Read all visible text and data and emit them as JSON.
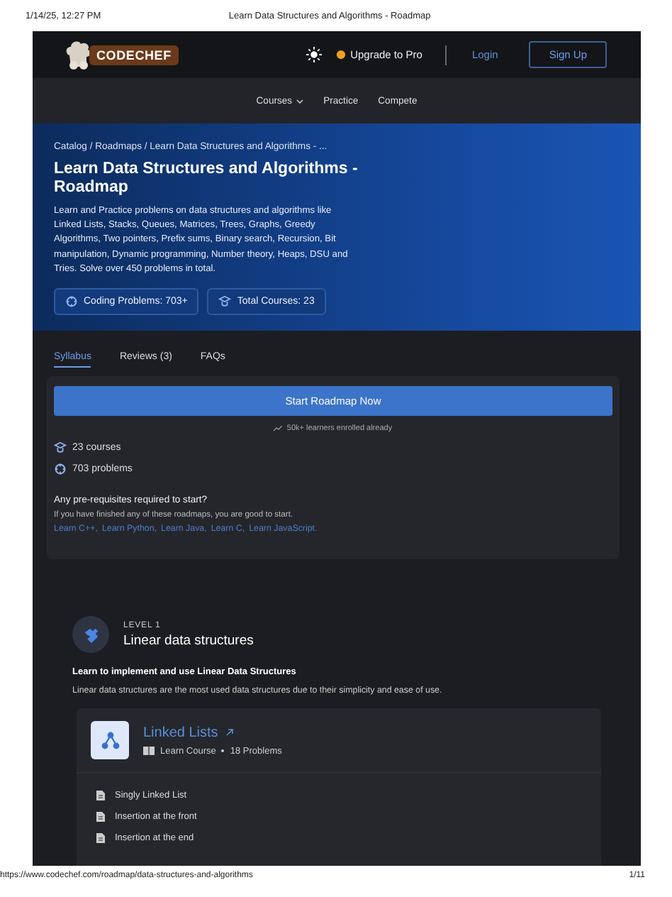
{
  "print_header": {
    "date": "1/14/25, 12:27 PM",
    "title": "Learn Data Structures and Algorithms - Roadmap"
  },
  "header": {
    "logo": "CODECHEF",
    "upgrade": "Upgrade to Pro",
    "login": "Login",
    "signup": "Sign Up"
  },
  "nav": [
    {
      "label": "Courses",
      "dropdown": true
    },
    {
      "label": "Practice",
      "dropdown": false
    },
    {
      "label": "Compete",
      "dropdown": false
    }
  ],
  "hero": {
    "breadcrumb": "Catalog / Roadmaps / Learn Data Structures and Algorithms - ...",
    "title": "Learn Data Structures and Algorithms - Roadmap",
    "description": "Learn and Practice problems on data structures and algorithms like Linked Lists, Stacks, Queues, Matrices, Trees, Graphs, Greedy Algorithms, Two pointers, Prefix sums, Binary search, Recursion, Bit manipulation, Dynamic programming, Number theory, Heaps, DSU and Tries. Solve over 450 problems in total.",
    "stats": [
      {
        "kind": "problems",
        "label": "Coding Problems: 703+"
      },
      {
        "kind": "courses",
        "label": "Total Courses: 23"
      }
    ]
  },
  "tabs": [
    {
      "label": "Syllabus",
      "selected": true
    },
    {
      "label": "Reviews (3)",
      "selected": false
    },
    {
      "label": "FAQs",
      "selected": false
    }
  ],
  "start": {
    "button": "Start Roadmap Now",
    "enrolled": "50k+ learners enrolled already",
    "facts": [
      {
        "kind": "courses",
        "label": "23 courses"
      },
      {
        "kind": "problems",
        "label": "703 problems"
      }
    ],
    "prereq_title": "Any pre-requisites required to start?",
    "prereq_text": "If you have finished any of these roadmaps, you are good to start.",
    "links": [
      "Learn C++,",
      "Learn Python,",
      "Learn Java,",
      "Learn C,",
      "Learn JavaScript."
    ]
  },
  "level": {
    "label": "LEVEL 1",
    "title": "Linear data structures",
    "subtitle": "Learn to implement and use Linear Data Structures",
    "text": "Linear data structures are the most used data structures due to their simplicity and ease of use."
  },
  "course": {
    "title": "Linked Lists",
    "type": "Learn Course",
    "problems": "18 Problems",
    "lessons": [
      "Singly Linked List",
      "Insertion at the front",
      "Insertion at the end"
    ]
  },
  "print_footer": {
    "url": "https://www.codechef.com/roadmap/data-structures-and-algorithms",
    "page": "1/11"
  }
}
